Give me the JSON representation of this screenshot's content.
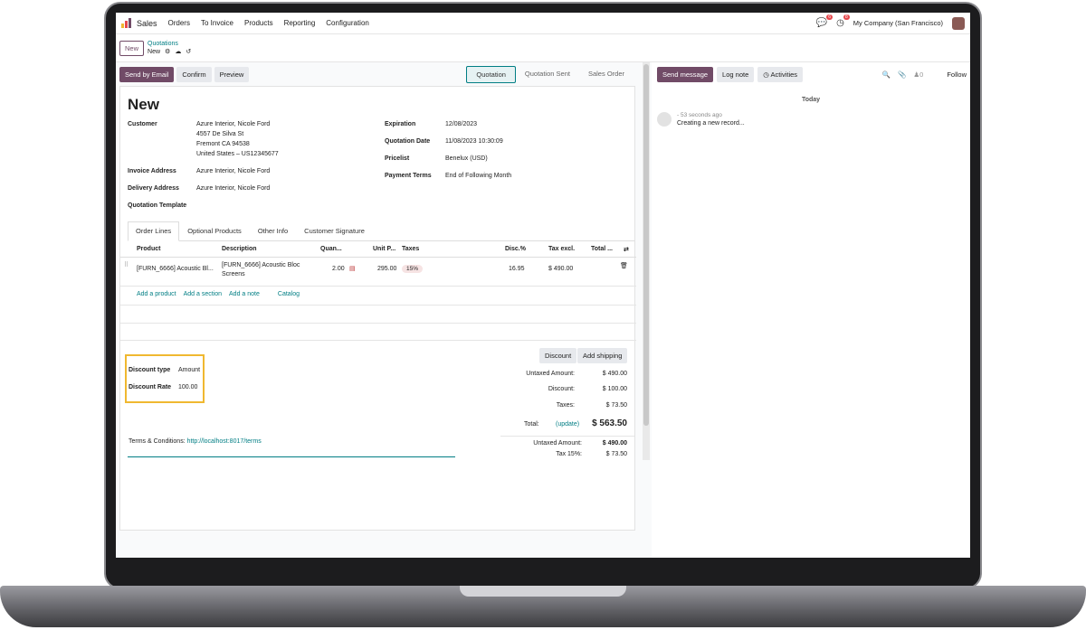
{
  "topbar": {
    "app_name": "Sales",
    "menu": [
      "Orders",
      "To Invoice",
      "Products",
      "Reporting",
      "Configuration"
    ],
    "chat_count": "6",
    "activity_count": "8",
    "company": "My Company (San Francisco)"
  },
  "subbar": {
    "new_button": "New",
    "breadcrumb_parent": "Quotations",
    "breadcrumb_current": "New"
  },
  "actions": {
    "send_by_email": "Send by Email",
    "confirm": "Confirm",
    "preview": "Preview",
    "statuses": [
      "Quotation",
      "Quotation Sent",
      "Sales Order"
    ]
  },
  "form": {
    "title": "New",
    "customer_label": "Customer",
    "customer_lines": [
      "Azure Interior, Nicole Ford",
      "4557 De Silva St",
      "Fremont CA 94538",
      "United States – US12345677"
    ],
    "invoice_address_label": "Invoice Address",
    "invoice_address": "Azure Interior, Nicole Ford",
    "delivery_address_label": "Delivery Address",
    "delivery_address": "Azure Interior, Nicole Ford",
    "template_label": "Quotation Template",
    "expiration_label": "Expiration",
    "expiration": "12/08/2023",
    "quotation_date_label": "Quotation Date",
    "quotation_date": "11/08/2023 10:30:09",
    "pricelist_label": "Pricelist",
    "pricelist": "Benelux (USD)",
    "payment_terms_label": "Payment Terms",
    "payment_terms": "End of Following Month"
  },
  "tabs": [
    "Order Lines",
    "Optional Products",
    "Other Info",
    "Customer Signature"
  ],
  "table": {
    "headers": [
      "Product",
      "Description",
      "Quan...",
      "Unit P...",
      "Taxes",
      "Disc.%",
      "Tax excl.",
      "Total ..."
    ],
    "row": {
      "product": "[FURN_6666] Acoustic Bl...",
      "description": "[FURN_6666] Acoustic Bloc Screens",
      "quantity": "2.00",
      "unit_price": "295.00",
      "tax": "15%",
      "discount": "16.95",
      "tax_excl": "$ 490.00"
    },
    "links": [
      "Add a product",
      "Add a section",
      "Add a note",
      "Catalog"
    ]
  },
  "discount": {
    "type_label": "Discount type",
    "type_value": "Amount",
    "rate_label": "Discount Rate",
    "rate_value": "100.00",
    "discount_button": "Discount",
    "shipping_button": "Add shipping"
  },
  "totals": {
    "untaxed_label": "Untaxed Amount:",
    "untaxed": "$ 490.00",
    "discount_label": "Discount:",
    "discount": "$ 100.00",
    "taxes_label": "Taxes:",
    "taxes": "$ 73.50",
    "total_label": "Total:",
    "update": "(update)",
    "total": "$ 563.50",
    "untaxed2_label": "Untaxed Amount:",
    "untaxed2": "$ 490.00",
    "tax15_label": "Tax 15%:",
    "tax15": "$ 73.50"
  },
  "terms": {
    "label": "Terms & Conditions:",
    "link": "http://localhost:8017/terms"
  },
  "chatter": {
    "send_message": "Send message",
    "log_note": "Log note",
    "activities": "Activities",
    "followers_count": "0",
    "follow": "Follow",
    "today": "Today",
    "msg_time": "- 53 seconds ago",
    "msg_text": "Creating a new record..."
  }
}
